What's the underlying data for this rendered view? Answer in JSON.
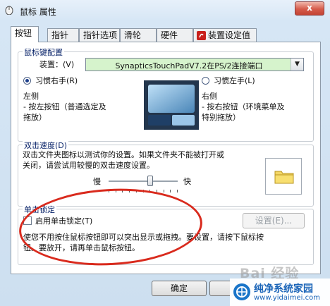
{
  "window": {
    "title": "鼠标 属性",
    "close_label": "x"
  },
  "tabs": [
    {
      "label": "按钮",
      "active": true
    },
    {
      "label": "指针"
    },
    {
      "label": "指针选项"
    },
    {
      "label": "滑轮"
    },
    {
      "label": "硬件"
    },
    {
      "label": "装置设定值",
      "icon": "synaptics-icon"
    }
  ],
  "button_config": {
    "title": "鼠标键配置",
    "device_label": "装置：(V)",
    "device_value": "SynapticsTouchPadV7.2在PS/2连接端口",
    "right_hand_label": "习惯右手(R)",
    "left_hand_label": "习惯左手(L)",
    "left_caption": "左侧\n - 按左按钮（普通选定及\n拖放）",
    "right_caption": "右侧\n - 按右按钮（环境菜单及\n特别拖放）"
  },
  "double_click": {
    "title": "双击速度(D)",
    "description": "双击文件夹图标以测试你的设置。如果文件夹不能被打开或\n关闭，请尝试用较慢的双击速度设置。",
    "slow_label": "慢",
    "fast_label": "快",
    "speed_level": 0.6,
    "folder_icon": "folder-icon"
  },
  "click_lock": {
    "title": "单击锁定",
    "checkbox_label": "启用单击锁定(T)",
    "checked": false,
    "settings_label": "设置(E)...",
    "description": "使您不用按住鼠标按钮即可以突出显示或拖拽。要设置，请按下鼠标按\n钮。要放开，请再单击鼠标按钮。"
  },
  "footer": {
    "ok_label": "确定"
  },
  "watermark": {
    "text": "Bai 经验"
  },
  "brand": {
    "name": "纯净系统家园",
    "url": "www.yidaimei.com"
  },
  "colors": {
    "device_select_bg": "#d6f3cc",
    "annotation_red": "#d92a1d",
    "brand_blue": "#1a64b8"
  }
}
